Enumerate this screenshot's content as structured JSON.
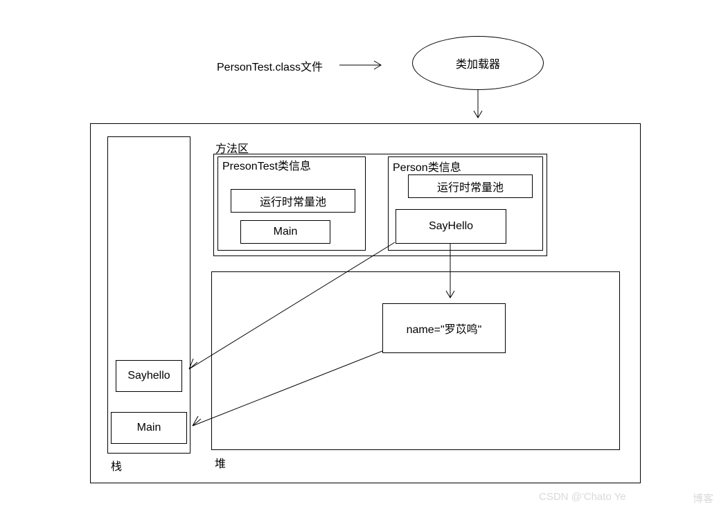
{
  "top": {
    "file_label": "PersonTest.class文件",
    "loader_label": "类加载器"
  },
  "region_labels": {
    "method_area": "方法区",
    "stack": "栈",
    "heap": "堆"
  },
  "method_area": {
    "class1": {
      "title": "PresonTest类信息",
      "const_pool": "运行时常量池",
      "method": "Main"
    },
    "class2": {
      "title": "Person类信息",
      "const_pool": "运行时常量池",
      "method": "SayHello"
    }
  },
  "heap": {
    "object1": "name=\"罗苡鸣\""
  },
  "stack": {
    "frame1": "Sayhello",
    "frame2": "Main"
  },
  "watermark": {
    "left": "CSDN @'Chato Ye",
    "right": "博客"
  }
}
